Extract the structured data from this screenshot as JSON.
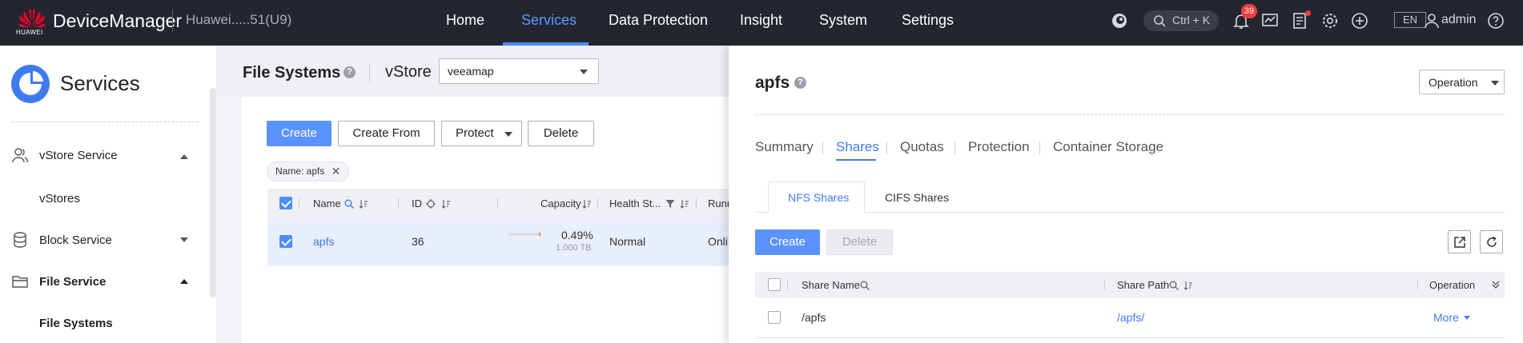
{
  "header": {
    "logo_text": "HUAWEI",
    "brand": "DeviceManager",
    "device": "Huawei.....51(U9)",
    "nav": [
      {
        "label": "Home",
        "active": false
      },
      {
        "label": "Services",
        "active": true
      },
      {
        "label": "Data Protection",
        "active": false
      },
      {
        "label": "Insight",
        "active": false
      },
      {
        "label": "System",
        "active": false
      },
      {
        "label": "Settings",
        "active": false
      }
    ],
    "search_shortcut": "Ctrl + K",
    "alarm_count": "39",
    "language": "EN",
    "user": "admin"
  },
  "sidebar": {
    "title": "Services",
    "items": [
      {
        "label": "vStore Service",
        "icon": "users-icon",
        "expanded": true
      },
      {
        "label": "vStores"
      },
      {
        "label": "Block Service",
        "icon": "cylinder-icon",
        "expanded": false
      },
      {
        "label": "File Service",
        "icon": "folder-icon",
        "expanded": true
      },
      {
        "label": "File Systems"
      }
    ]
  },
  "file_systems": {
    "title": "File Systems",
    "vstore_label": "vStore",
    "vstore_value": "veeamap",
    "buttons": {
      "create": "Create",
      "create_from": "Create From",
      "protect": "Protect",
      "delete": "Delete"
    },
    "filter_tag": "Name: apfs",
    "columns": [
      "Name",
      "ID",
      "Capacity",
      "Health St...",
      "Runn"
    ],
    "rows": [
      {
        "name": "apfs",
        "id": "36",
        "capacity_pct": "0.49%",
        "capacity_total": "1.000 TB",
        "health": "Normal",
        "running": "Onli",
        "usage_fraction": 0.0049
      }
    ]
  },
  "detail": {
    "title": "apfs",
    "operation": "Operation",
    "tabs": [
      {
        "label": "Summary",
        "active": false
      },
      {
        "label": "Shares",
        "active": true
      },
      {
        "label": "Quotas",
        "active": false
      },
      {
        "label": "Protection",
        "active": false
      },
      {
        "label": "Container Storage",
        "active": false
      }
    ],
    "subtabs": [
      {
        "label": "NFS Shares",
        "active": true
      },
      {
        "label": "CIFS Shares",
        "active": false
      }
    ],
    "buttons": {
      "create": "Create",
      "delete": "Delete"
    },
    "columns": {
      "share_name": "Share Name",
      "share_path": "Share Path",
      "operation": "Operation"
    },
    "rows": [
      {
        "share_name": "/apfs",
        "share_path": "/apfs/",
        "action": "More"
      }
    ]
  },
  "colors": {
    "accent": "#4c8dff",
    "topbar": "#23262f",
    "alarm": "#f03d3d"
  }
}
